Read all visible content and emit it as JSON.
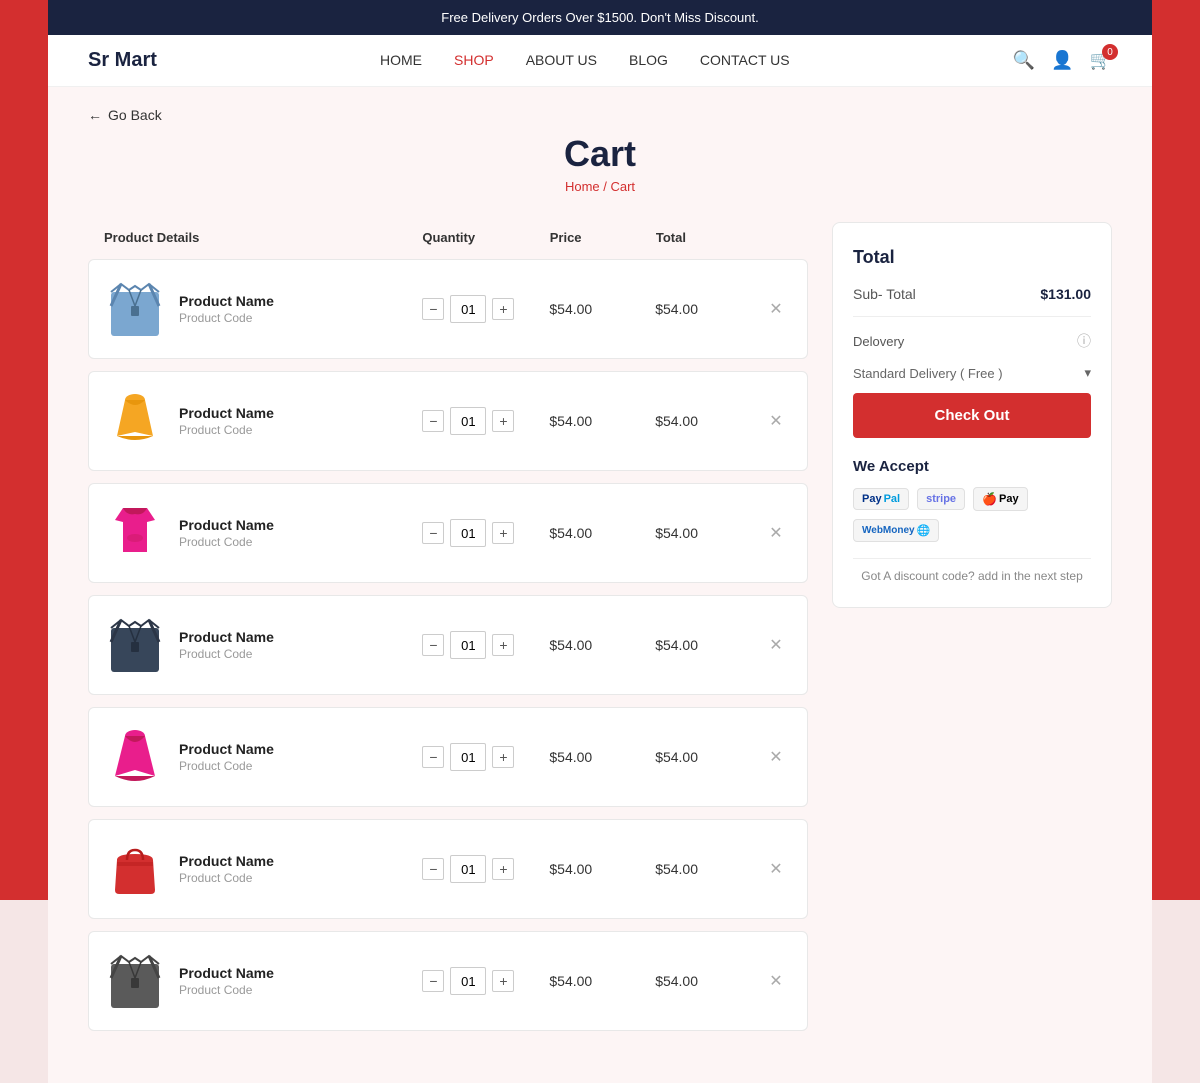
{
  "announcement": {
    "text": "Free Delivery Orders Over $1500. Don't Miss Discount."
  },
  "header": {
    "logo": "Sr Mart",
    "nav": [
      {
        "label": "HOME",
        "active": false
      },
      {
        "label": "SHOP",
        "active": true
      },
      {
        "label": "ABOUT US",
        "active": false
      },
      {
        "label": "BLOG",
        "active": false
      },
      {
        "label": "CONTACT US",
        "active": false
      }
    ],
    "cart_count": "0"
  },
  "page": {
    "go_back": "Go Back",
    "title": "Cart",
    "breadcrumb_home": "Home",
    "breadcrumb_separator": " / ",
    "breadcrumb_current": "Cart"
  },
  "table_headers": {
    "product_details": "Product Details",
    "quantity": "Quantity",
    "price": "Price",
    "total": "Total"
  },
  "cart_items": [
    {
      "id": 1,
      "name": "Product Name",
      "code": "Product Code",
      "quantity": "01",
      "price": "$54.00",
      "total": "$54.00",
      "color": "#5b7fa6",
      "type": "jacket"
    },
    {
      "id": 2,
      "name": "Product Name",
      "code": "Product Code",
      "quantity": "01",
      "price": "$54.00",
      "total": "$54.00",
      "color": "#f5a623",
      "type": "dress"
    },
    {
      "id": 3,
      "name": "Product Name",
      "code": "Product Code",
      "quantity": "01",
      "price": "$54.00",
      "total": "$54.00",
      "color": "#e91e8c",
      "type": "top"
    },
    {
      "id": 4,
      "name": "Product Name",
      "code": "Product Code",
      "quantity": "01",
      "price": "$54.00",
      "total": "$54.00",
      "color": "#2c3e6b",
      "type": "jacket"
    },
    {
      "id": 5,
      "name": "Product Name",
      "code": "Product Code",
      "quantity": "01",
      "price": "$54.00",
      "total": "$54.00",
      "color": "#e91e8c",
      "type": "dress"
    },
    {
      "id": 6,
      "name": "Product Name",
      "code": "Product Code",
      "quantity": "01",
      "price": "$54.00",
      "total": "$54.00",
      "color": "#c0392b",
      "type": "bag"
    },
    {
      "id": 7,
      "name": "Product Name",
      "code": "Product Code",
      "quantity": "01",
      "price": "$54.00",
      "total": "$54.00",
      "color": "#4a4a4a",
      "type": "jacket"
    }
  ],
  "summary": {
    "title": "Total",
    "subtotal_label": "Sub- Total",
    "subtotal_value": "$131.00",
    "delivery_label": "Delovery",
    "standard_delivery": "Standard Delivery ( Free )",
    "checkout_label": "Check Out",
    "we_accept": "We Accept",
    "discount_note": "Got A discount code? add in the next step",
    "payment_methods": [
      {
        "label": "PayPal",
        "class": "paypal"
      },
      {
        "label": "Stripe",
        "class": "stripe"
      },
      {
        "label": "Apple Pay",
        "class": "applepay"
      },
      {
        "label": "WebMoney",
        "class": "webmoney"
      }
    ]
  }
}
